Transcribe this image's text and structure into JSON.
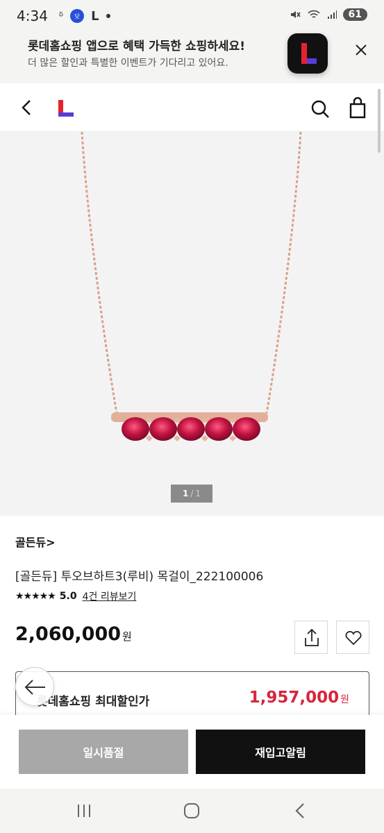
{
  "status_bar": {
    "time": "4:34",
    "badge": "닷",
    "app_letter": "L",
    "battery": "61"
  },
  "banner": {
    "title": "롯데홈쇼핑 앱으로 혜택 가득한 쇼핑하세요!",
    "subtitle": "더 많은 할인과 특별한 이벤트가 기다리고 있어요."
  },
  "gallery": {
    "current": "1",
    "separator": "/",
    "total": "1"
  },
  "product": {
    "brand": "골든듀",
    "brand_chevron": ">",
    "name": "[골든듀] 투오브하트3(루비) 목걸이_222100006",
    "stars": "★★★★★",
    "rating": "5.0",
    "review_link": "4건 리뷰보기",
    "price": "2,060,000",
    "price_unit": "원"
  },
  "discount": {
    "label": "롯데홈쇼핑 최대할인가",
    "price": "1,957,000",
    "unit": "원"
  },
  "actions": {
    "soldout_label": "일시품절",
    "restock_label": "재입고알림"
  },
  "colors": {
    "accent_red": "#d8243c",
    "logo_red": "#e5232f",
    "logo_purple": "#5a3bd6",
    "primary_dark": "#111111",
    "disabled_gray": "#a8a8a8"
  }
}
